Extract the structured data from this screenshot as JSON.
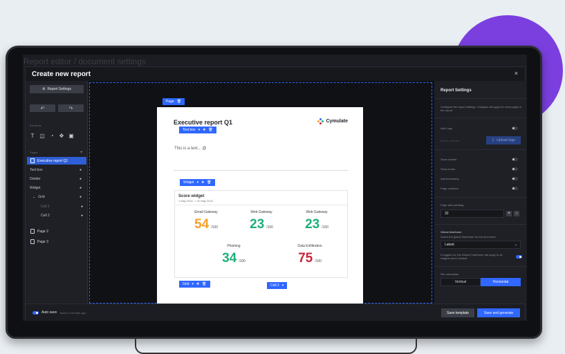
{
  "background_title": "Report editor / document settings",
  "modal": {
    "title": "Create new report",
    "close": "×"
  },
  "left_panel": {
    "report_settings_button": "Report Settings",
    "undo": "↶",
    "redo": "↷",
    "elements_label": "Elements",
    "pages_label": "Pages",
    "add_page": "+",
    "pages": [
      {
        "label": "Executive report Q1",
        "selected": true
      },
      {
        "label": "Page 2"
      },
      {
        "label": "Page 3"
      }
    ],
    "tree": [
      {
        "label": "Text box"
      },
      {
        "label": "Divider"
      },
      {
        "label": "Widget"
      },
      {
        "label": "Grid"
      },
      {
        "label": "Cell 1"
      },
      {
        "label": "Cell 2"
      }
    ]
  },
  "canvas": {
    "page_tag": "Page",
    "report_title": "Executive report Q1",
    "logo_text": "Cymulate",
    "text_box_tag": "Text box",
    "text_content": "This is a text... @",
    "widget_tag": "Widget",
    "grid_tag": "Grid",
    "cell_tag": "Cell 2",
    "widget": {
      "title": "Score widget",
      "date_range": "1 May 2022 -> 31 May 2022",
      "scores": [
        {
          "name": "Email Gateway",
          "value": "54",
          "denominator": "/100",
          "color": "#f5a02a"
        },
        {
          "name": "Web Gateway",
          "value": "23",
          "denominator": "/100",
          "color": "#1faf7a"
        },
        {
          "name": "Web Gateway",
          "value": "23",
          "denominator": "/100",
          "color": "#1faf7a"
        },
        {
          "name": "Phishing",
          "value": "34",
          "denominator": "/100",
          "color": "#1faf7a"
        },
        {
          "name": "Data Exfiltration",
          "value": "75",
          "denominator": "/100",
          "color": "#c8253a"
        }
      ]
    }
  },
  "right_panel": {
    "title": "Report Settings",
    "description": "Configure the report settings. Changes will apply for every page in the report.",
    "add_logo": "Add Logo",
    "upload_placeholder": "No file selected",
    "upload_button": "Upload logo",
    "show_header": "Show header",
    "show_footer": "Show footer",
    "add_timestamp": "Add timestamp",
    "page_numbers": "Page numbers",
    "padding_label": "Page side padding",
    "padding_value": "32",
    "global_timeframe_label": "Global timeframe",
    "global_timeframe_desc": "Select the global timeframe for the document.",
    "timeframe_value": "Latest",
    "timeframe_note": "If toggled on, the Global Timeframe will apply to all widgets set to Default.",
    "orientation_label": "File orientation",
    "orientation_options": [
      "Vertical",
      "Horizontal"
    ],
    "orientation_selected": "Horizontal"
  },
  "bottom_bar": {
    "autosave_label": "Auto save",
    "saved_text": "Saved 2 minutes ago",
    "save_template": "Save template",
    "save_generate": "Save and generate"
  },
  "colors": {
    "accent": "#2f67ff",
    "blob": "#7b3fe0"
  }
}
